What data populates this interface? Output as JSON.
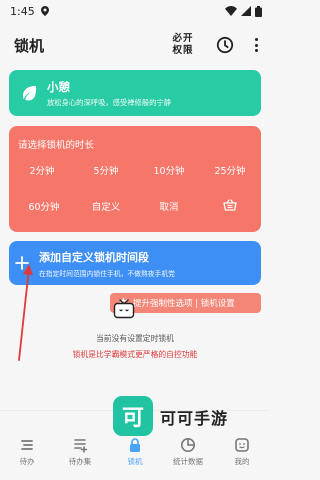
{
  "status": {
    "time": "1:45"
  },
  "appbar": {
    "title": "锁机",
    "perm_line1": "必开",
    "perm_line2": "权限"
  },
  "green_card": {
    "title": "小憩",
    "subtitle": "放松身心的深呼吸，感受禅修般的宁静"
  },
  "red_card": {
    "header": "请选择锁机的时长",
    "options": [
      "2分钟",
      "5分钟",
      "10分钟",
      "25分钟",
      "60分钟",
      "自定义",
      "取消"
    ]
  },
  "blue_card": {
    "title": "添加自定义锁机时间段",
    "subtitle": "在指定时间范围内锁住手机，不做熬夜手机党"
  },
  "pill": {
    "label": "提升强制性选项 | 锁机设置"
  },
  "empty": {
    "text": "当前没有设置定时锁机",
    "warning": "锁机是比学霸模式更严格的自控功能"
  },
  "nav": {
    "items": [
      "待办",
      "待办集",
      "锁机",
      "统计数据",
      "我的"
    ],
    "active": "锁机"
  },
  "watermark": {
    "logo_char": "可",
    "text": "可可手游"
  },
  "colors": {
    "green": "#27cba4",
    "red": "#f6766a",
    "blue": "#3d8ff5",
    "accent": "#4aa4f7"
  }
}
